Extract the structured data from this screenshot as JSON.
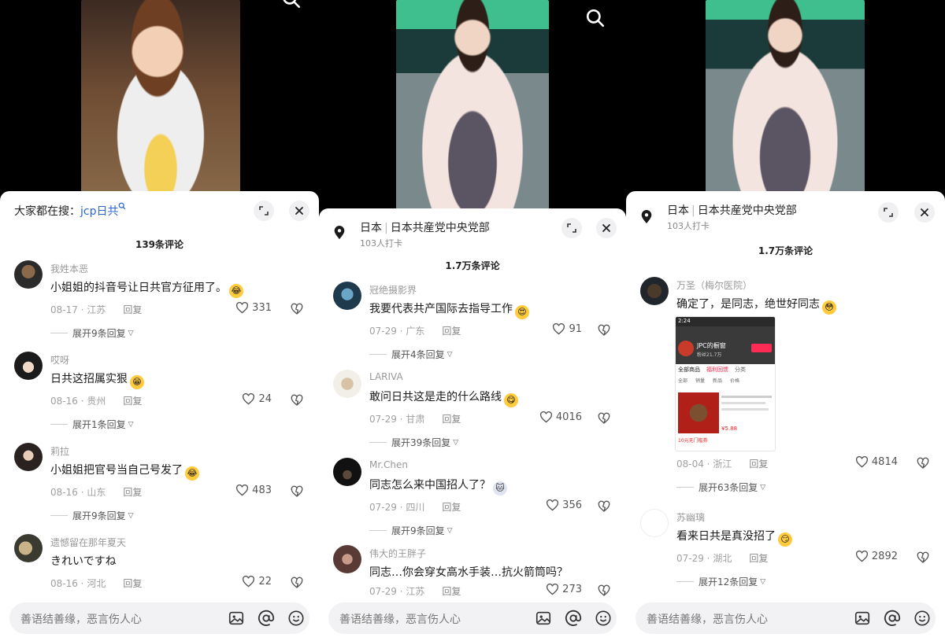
{
  "panels": [
    {
      "header": {
        "search_label": "大家都在搜：",
        "search_keyword": "jcp日共"
      },
      "count": "139条评论",
      "comments": [
        {
          "user": "我姓本恶",
          "text": "小姐姐的抖音号让日共官方征用了。",
          "emoji": "laugh-cry",
          "date": "08-17 · 江苏",
          "reply": "回复",
          "likes": "331",
          "expand": "展开9条回复"
        },
        {
          "user": "哎呀",
          "text": "日共这招属实狠",
          "emoji": "grin",
          "date": "08-16 · 贵州",
          "reply": "回复",
          "likes": "24",
          "expand": "展开1条回复"
        },
        {
          "user": "莉拉",
          "text": "小姐姐把官号当自己号发了",
          "emoji": "laugh-cry",
          "date": "08-16 · 山东",
          "reply": "回复",
          "likes": "483",
          "expand": "展开9条回复"
        },
        {
          "user": "遗憾留在那年夏天",
          "text": "きれいですね",
          "date": "08-16 · 河北",
          "reply": "回复",
          "likes": "22"
        }
      ],
      "input_placeholder": "善语结善缘，恶言伤人心"
    },
    {
      "header": {
        "place": "日本",
        "place_detail": "日本共産党中央党部",
        "checkins": "103人打卡"
      },
      "count": "1.7万条评论",
      "comments": [
        {
          "user": "冠绝摄影界",
          "text": "我要代表共产国际去指导工作",
          "emoji": "heart-eyes",
          "date": "07-29 · 广东",
          "reply": "回复",
          "likes": "91",
          "expand": "展开4条回复"
        },
        {
          "user": "LARIVA",
          "text": "敢问日共这是走的什么路线",
          "emoji": "yum",
          "date": "07-29 · 甘肃",
          "reply": "回复",
          "likes": "4016",
          "expand": "展开39条回复"
        },
        {
          "user": "Mr.Chen",
          "text": "同志怎么来中国招人了？",
          "emoji": "cat",
          "date": "07-29 · 四川",
          "reply": "回复",
          "likes": "356",
          "expand": "展开9条回复"
        },
        {
          "user": "伟大的王胖子",
          "text": "同志…你会穿女高水手装…抗火箭筒吗？",
          "date": "07-29 · 江苏",
          "reply": "回复",
          "likes": "273"
        }
      ],
      "input_placeholder": "善语结善缘，恶言伤人心"
    },
    {
      "header": {
        "place": "日本",
        "place_detail": "日本共産党中央党部",
        "checkins": "103人打卡"
      },
      "count": "1.7万条评论",
      "comments": [
        {
          "user": "万圣（梅尔医院）",
          "text": "确定了，是同志，绝世好同志",
          "emoji": "flushed",
          "date": "08-04 · 浙江",
          "reply": "回复",
          "likes": "4814",
          "expand": "展开63条回复",
          "screenshot": {
            "time": "2:24",
            "shop": "JPC的橱窗",
            "followers": "粉丝21.7万",
            "tabs": [
              "全部商品",
              "福利回馈",
              "分类"
            ],
            "sort": [
              "全部",
              "销量",
              "新品",
              "价格"
            ],
            "price": "¥5.88",
            "coupon": "10元无门槛券"
          }
        },
        {
          "user": "苏幽璃",
          "text": "看来日共是真没招了",
          "emoji": "smirk",
          "date": "07-29 · 湖北",
          "reply": "回复",
          "likes": "2892",
          "expand": "展开12条回复"
        }
      ],
      "input_placeholder": "善语结善缘，恶言伤人心"
    }
  ]
}
